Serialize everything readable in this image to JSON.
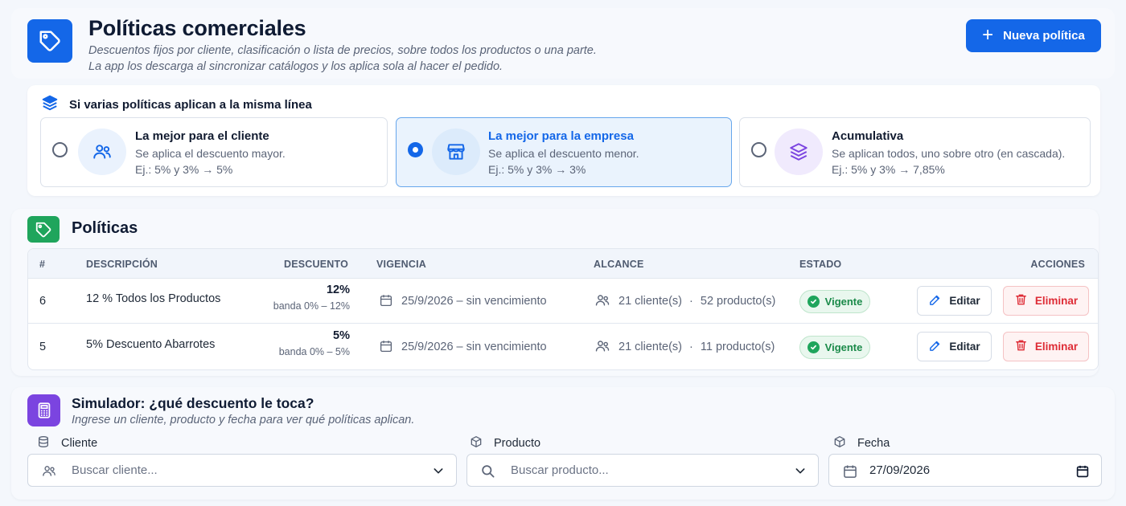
{
  "header": {
    "title": "Políticas comerciales",
    "subtitle_line1": "Descuentos fijos por cliente, clasificación o lista de precios, sobre todos los productos o una parte.",
    "subtitle_line2": "La app los descarga al sincronizar catálogos y los aplica sola al hacer el pedido.",
    "new_button": "Nueva política"
  },
  "conflict": {
    "title": "Si varias políticas aplican a la misma línea",
    "options": [
      {
        "title": "La mejor para el cliente",
        "desc": "Se aplica el descuento mayor.",
        "example": "Ej.: 5% y 3% → 5%",
        "selected": false
      },
      {
        "title": "La mejor para la empresa",
        "desc": "Se aplica el descuento menor.",
        "example": "Ej.: 5% y 3% → 3%",
        "selected": true
      },
      {
        "title": "Acumulativa",
        "desc": "Se aplican todos, uno sobre otro (en cascada).",
        "example": "Ej.: 5% y 3% → 7,85%",
        "selected": false
      }
    ]
  },
  "policies": {
    "title": "Políticas",
    "columns": {
      "num": "#",
      "description": "DESCRIPCIÓN",
      "discount": "DESCUENTO",
      "validity": "VIGENCIA",
      "scope": "ALCANCE",
      "status": "ESTADO",
      "actions": "ACCIONES"
    },
    "rows": [
      {
        "num": "6",
        "description": "12 % Todos los Productos",
        "discount": "12%",
        "band": "banda 0% – 12%",
        "validity": "25/9/2026 – sin vencimiento",
        "clients": "21 cliente(s)",
        "sep": "·",
        "products": "52 producto(s)",
        "status": "Vigente",
        "edit": "Editar",
        "delete": "Eliminar"
      },
      {
        "num": "5",
        "description": "5% Descuento Abarrotes",
        "discount": "5%",
        "band": "banda 0% – 5%",
        "validity": "25/9/2026 – sin vencimiento",
        "clients": "21 cliente(s)",
        "sep": "·",
        "products": "11 producto(s)",
        "status": "Vigente",
        "edit": "Editar",
        "delete": "Eliminar"
      }
    ]
  },
  "simulator": {
    "title": "Simulador: ¿qué descuento le toca?",
    "subtitle": "Ingrese un cliente, producto y fecha para ver qué políticas aplican.",
    "client_label": "Cliente",
    "client_placeholder": "Buscar cliente...",
    "product_label": "Producto",
    "product_placeholder": "Buscar producto...",
    "date_label": "Fecha",
    "date_value": "27/09/2026"
  },
  "colors": {
    "primary": "#1467e8",
    "success": "#1fa55c",
    "danger": "#de2b35",
    "purple": "#7b44e0"
  },
  "icons": [
    "tag-icon",
    "plus-icon",
    "layers-icon",
    "users-icon",
    "store-icon",
    "calendar-icon",
    "check-circle-icon",
    "pencil-icon",
    "trash-icon",
    "calculator-icon",
    "database-icon",
    "box-icon",
    "search-icon",
    "chevron-down-icon"
  ]
}
